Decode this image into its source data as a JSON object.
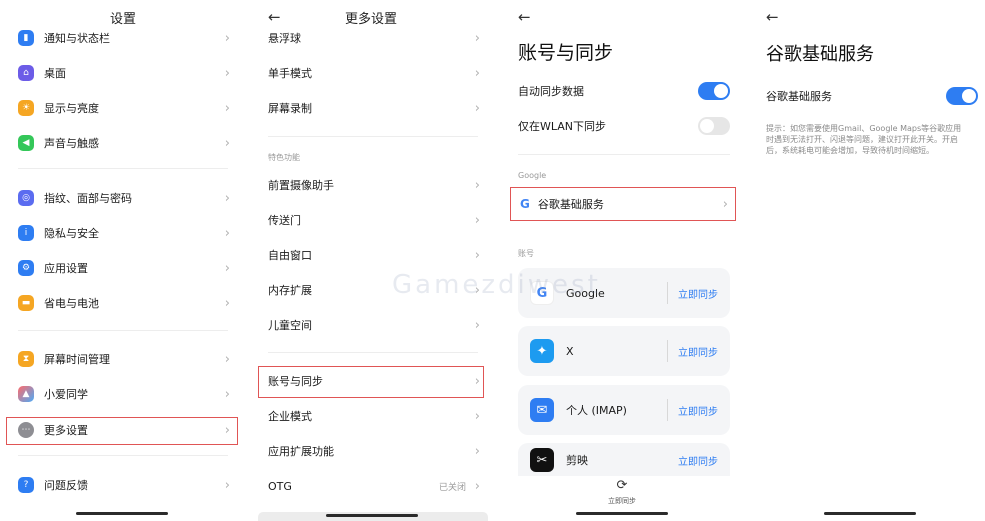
{
  "panel1": {
    "title": "设置",
    "items": [
      {
        "label": "通知与状态栏",
        "icon": "notification-icon",
        "color": "#2e7df2"
      },
      {
        "label": "桌面",
        "icon": "home-icon",
        "color": "#6c5ce7"
      },
      {
        "label": "显示与亮度",
        "icon": "sun-icon",
        "color": "#f5a623"
      },
      {
        "label": "声音与触感",
        "icon": "sound-icon",
        "color": "#34c759"
      },
      {
        "label": "指纹、面部与密码",
        "icon": "fingerprint-icon",
        "color": "#5b6cf0"
      },
      {
        "label": "隐私与安全",
        "icon": "privacy-icon",
        "color": "#2e7df2"
      },
      {
        "label": "应用设置",
        "icon": "apps-icon",
        "color": "#2e7df2"
      },
      {
        "label": "省电与电池",
        "icon": "battery-icon",
        "color": "#f5a623"
      },
      {
        "label": "屏幕时间管理",
        "icon": "hourglass-icon",
        "color": "#f5a623"
      },
      {
        "label": "小爱同学",
        "icon": "assistant-icon",
        "color": "#ff6b6b"
      },
      {
        "label": "更多设置",
        "icon": "more-icon",
        "color": "#8e8e93"
      },
      {
        "label": "问题反馈",
        "icon": "feedback-icon",
        "color": "#2e7df2"
      }
    ]
  },
  "panel2": {
    "title": "更多设置",
    "section_label": "特色功能",
    "items": [
      {
        "label": "悬浮球"
      },
      {
        "label": "单手模式"
      },
      {
        "label": "屏幕录制"
      },
      {
        "label": "前置摄像助手"
      },
      {
        "label": "传送门"
      },
      {
        "label": "自由窗口"
      },
      {
        "label": "内存扩展"
      },
      {
        "label": "儿童空间"
      },
      {
        "label": "账号与同步"
      },
      {
        "label": "企业模式"
      },
      {
        "label": "应用扩展功能"
      },
      {
        "label": "OTG",
        "value": "已关闭"
      }
    ]
  },
  "panel3": {
    "title": "账号与同步",
    "auto_sync_label": "自动同步数据",
    "auto_sync_on": true,
    "wlan_only_label": "仅在WLAN下同步",
    "wlan_only_on": false,
    "google_section": "Google",
    "google_services_label": "谷歌基础服务",
    "accounts_section": "账号",
    "accounts": [
      {
        "name": "Google",
        "icon": "google-icon",
        "color": "#ffffff",
        "sync": "立即同步"
      },
      {
        "name": "X",
        "icon": "twitter-icon",
        "color": "#1d9bf0",
        "sync": "立即同步"
      },
      {
        "name": "个人 (IMAP)",
        "icon": "mail-icon",
        "color": "#2e7df2",
        "sync": "立即同步"
      },
      {
        "name": "剪映",
        "icon": "capcut-icon",
        "color": "#111111",
        "sync": "立即同步"
      }
    ],
    "bottom_action": "立即同步"
  },
  "panel4": {
    "title": "谷歌基础服务",
    "toggle_label": "谷歌基础服务",
    "toggle_on": true,
    "hint": "提示：如您需要使用Gmail、Google Maps等谷歌应用时遇到无法打开、闪退等问题，建议打开此开关。开启后，系统耗电可能会增加，导致待机时间缩短。"
  },
  "watermark": {
    "title": "Gamezdiwest"
  }
}
